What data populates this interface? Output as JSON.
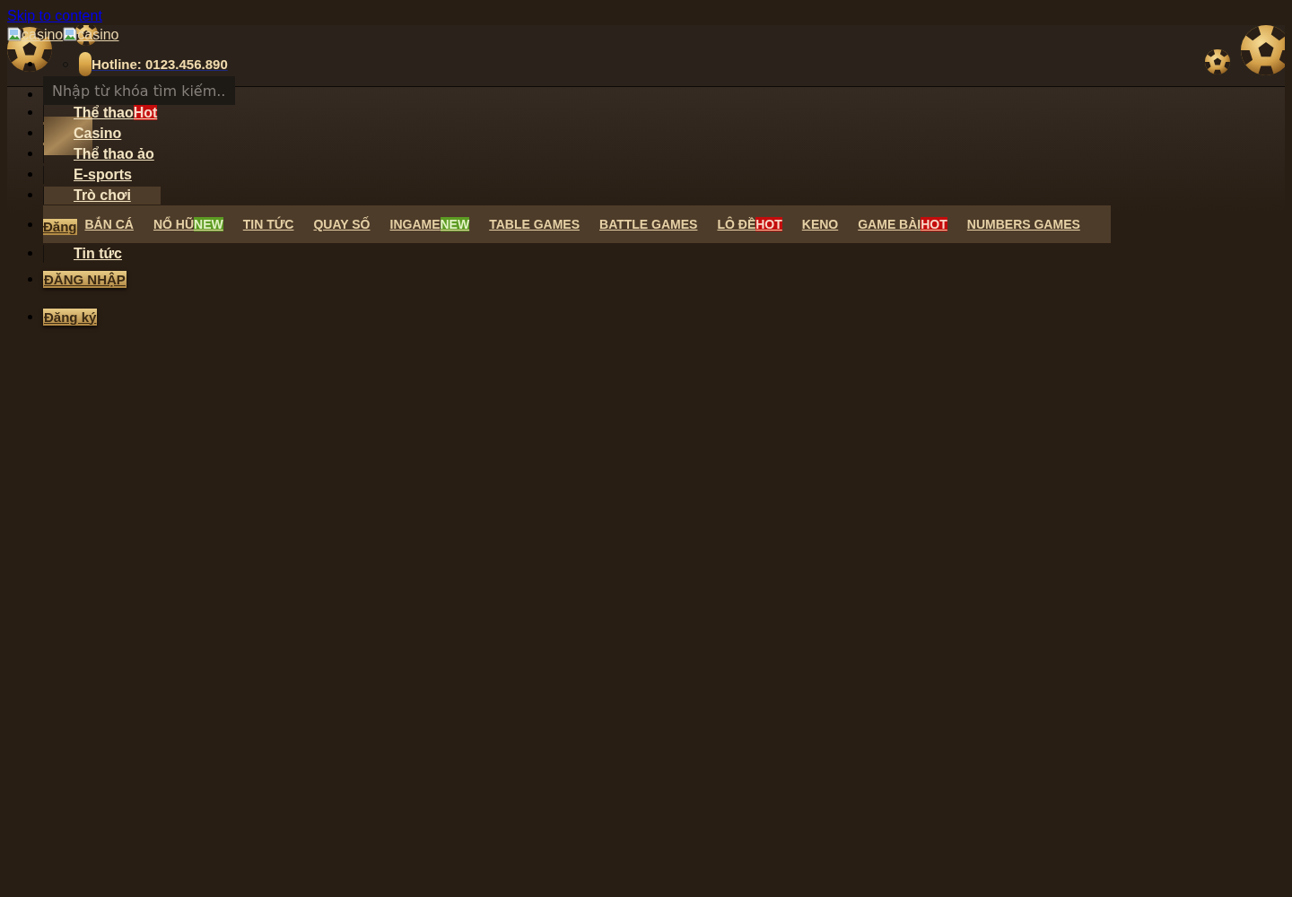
{
  "skip_link": {
    "label": "Skip to content"
  },
  "header": {
    "logos": [
      {
        "alt": "casino"
      },
      {
        "alt": "casino"
      }
    ],
    "hotline": "Hotline: 0123.456.890"
  },
  "search": {
    "placeholder": "Nhập từ khóa tìm kiếm.."
  },
  "menu": {
    "items": [
      {
        "label": "Thể thao",
        "badge": {
          "text": "Hot",
          "kind": "hot"
        },
        "selected": false
      },
      {
        "label": "Casino",
        "selected": false
      },
      {
        "label": "Thể thao ảo",
        "selected": false
      },
      {
        "label": "E-sports",
        "selected": false
      },
      {
        "label": "Trò chơi",
        "selected": true,
        "submenu": [
          {
            "label": "BẮN CÁ"
          },
          {
            "label": "NỔ HŨ",
            "badge": {
              "text": "NEW",
              "kind": "new"
            }
          },
          {
            "label": "TIN TỨC"
          },
          {
            "label": "QUAY SỐ"
          },
          {
            "label": "INGAME",
            "badge": {
              "text": "NEW",
              "kind": "new"
            }
          },
          {
            "label": "TABLE GAMES"
          },
          {
            "label": "BATTLE GAMES"
          },
          {
            "label": "LÔ ĐỀ",
            "badge": {
              "text": "HOT",
              "kind": "hot"
            }
          },
          {
            "label": "KENO"
          },
          {
            "label": "GAME BÀI",
            "badge": {
              "text": "HOT",
              "kind": "hot"
            }
          },
          {
            "label": "NUMBERS GAMES"
          }
        ]
      },
      {
        "label": "Tin tức",
        "selected": false
      }
    ]
  },
  "covered_button": {
    "label": "Đăng"
  },
  "buttons": [
    {
      "label": "ĐĂNG NHẬP"
    },
    {
      "label": "Đăng ký"
    }
  ]
}
